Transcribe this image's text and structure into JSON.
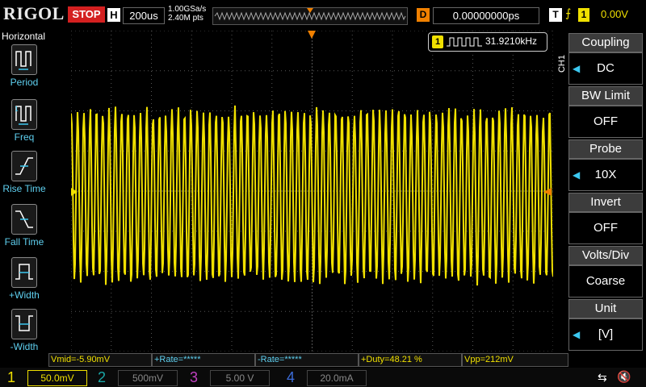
{
  "header": {
    "brand": "RIGOL",
    "run_state": "STOP",
    "horizontal_badge": "H",
    "timebase": "200us",
    "sample_rate": "1.00GSa/s",
    "memory_depth": "2.40M pts",
    "delay_badge": "D",
    "delay": "0.00000000ps",
    "trigger_badge": "T",
    "trigger_source": "1",
    "trigger_level": "0.00V"
  },
  "left_menu": {
    "title": "Horizontal",
    "items": [
      {
        "label": "Period",
        "icon": "period-icon"
      },
      {
        "label": "Freq",
        "icon": "frequency-icon"
      },
      {
        "label": "Rise Time",
        "icon": "rise-time-icon"
      },
      {
        "label": "Fall Time",
        "icon": "fall-time-icon"
      },
      {
        "label": "+Width",
        "icon": "positive-width-icon"
      },
      {
        "label": "-Width",
        "icon": "negative-width-icon"
      }
    ]
  },
  "frequency_counter": {
    "channel": "1",
    "value": "31.9210kHz"
  },
  "right_menu": {
    "channel_tag": "CH1",
    "items": [
      {
        "title": "Coupling",
        "value": "DC"
      },
      {
        "title": "BW Limit",
        "value": "OFF"
      },
      {
        "title": "Probe",
        "value": "10X"
      },
      {
        "title": "Invert",
        "value": "OFF"
      },
      {
        "title": "Volts/Div",
        "value": "Coarse"
      },
      {
        "title": "Unit",
        "value": "[V]"
      }
    ]
  },
  "measurements": [
    {
      "text": "Vmid=-5.90mV",
      "color": "#f0e000"
    },
    {
      "text": "+Rate=*****",
      "color": "#5fd0f0"
    },
    {
      "text": "-Rate=*****",
      "color": "#5fd0f0"
    },
    {
      "text": "+Duty=48.21 %",
      "color": "#f0e000"
    },
    {
      "text": "Vpp=212mV",
      "color": "#f0e000"
    }
  ],
  "channels": [
    {
      "num": "1",
      "scale": "50.0mV",
      "color": "#f0e000",
      "active": true
    },
    {
      "num": "2",
      "scale": "500mV",
      "color": "#1aa8a8",
      "active": false
    },
    {
      "num": "3",
      "scale": "5.00 V",
      "color": "#c040c0",
      "active": false
    },
    {
      "num": "4",
      "scale": "20.0mA",
      "color": "#3c6cd8",
      "active": false
    }
  ],
  "colors": {
    "ch1": "#f0e000",
    "trigger": "#f08000",
    "grid": "#555555",
    "menu_accent": "#3cc8f0"
  },
  "waveform": {
    "type": "sine",
    "frequency_khz": 31.921,
    "vpp_mv": 212,
    "vmid_mv": -5.9,
    "time_per_div_us": 200,
    "volts_per_div_mv": 50
  }
}
